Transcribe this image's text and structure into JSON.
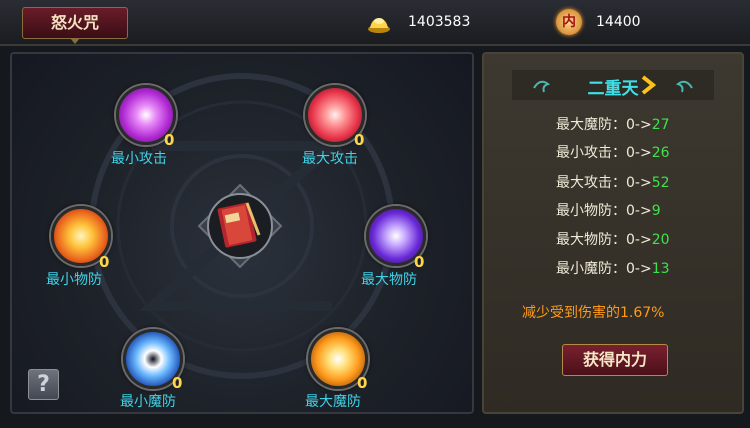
{
  "tab": {
    "label": "怒火咒"
  },
  "currency": {
    "gold": {
      "icon": "gold-ingot-icon",
      "value": "1403583"
    },
    "inner_power": {
      "icon": "inner-power-badge-icon",
      "badge_char": "内",
      "value": "14400"
    }
  },
  "nodes": [
    {
      "key": "min-attack",
      "label": "最小攻击",
      "level": "0",
      "color": "#c73ee0"
    },
    {
      "key": "max-attack",
      "label": "最大攻击",
      "level": "0",
      "color": "#ff5a4a"
    },
    {
      "key": "min-phys-def",
      "label": "最小物防",
      "level": "0",
      "color": "#ff8a1c"
    },
    {
      "key": "max-phys-def",
      "label": "最大物防",
      "level": "0",
      "color": "#7c4ce0"
    },
    {
      "key": "min-magic-def",
      "label": "最小魔防",
      "level": "0",
      "color": "#4aa0f0"
    },
    {
      "key": "max-magic-def",
      "label": "最大魔防",
      "level": "0",
      "color": "#ffb43a"
    }
  ],
  "center": {
    "icon": "spell-book-icon"
  },
  "help": {
    "label": "?"
  },
  "side": {
    "title": "二重天",
    "stats": [
      {
        "label": "最大魔防：0->",
        "value": "27"
      },
      {
        "label": "最小攻击：0->",
        "value": "26"
      },
      {
        "label": "最大攻击：0->",
        "value": "52"
      },
      {
        "label": "最小物防：0->",
        "value": "9"
      },
      {
        "label": "最大物防：0->",
        "value": "20"
      },
      {
        "label": "最小魔防：0->",
        "value": "13"
      }
    ],
    "damage_text": "减少受到伤害的1.67%",
    "button_label": "获得内力"
  },
  "colors": {
    "accent_cyan": "#40d3e8",
    "level_yellow": "#ffd54a",
    "value_green": "#3fe24a",
    "orange": "#ff9a1a"
  }
}
